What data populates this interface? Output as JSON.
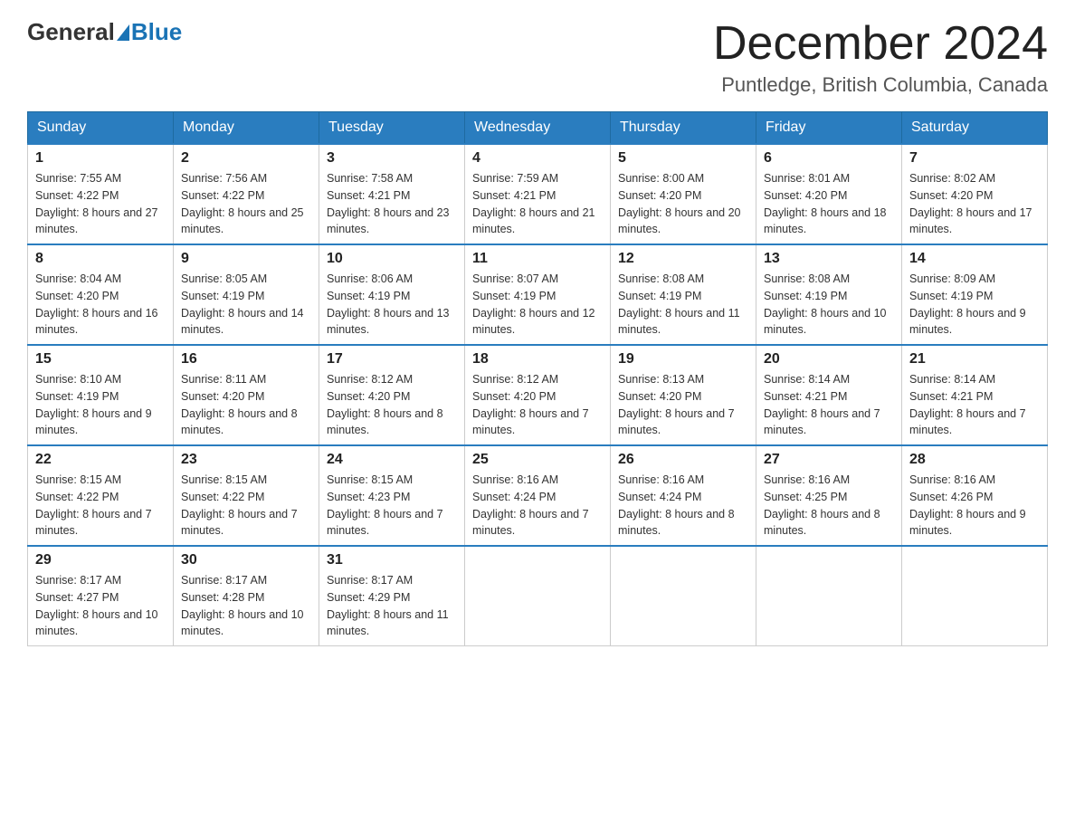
{
  "header": {
    "logo_general": "General",
    "logo_blue": "Blue",
    "month_title": "December 2024",
    "location": "Puntledge, British Columbia, Canada"
  },
  "days_of_week": [
    "Sunday",
    "Monday",
    "Tuesday",
    "Wednesday",
    "Thursday",
    "Friday",
    "Saturday"
  ],
  "weeks": [
    [
      {
        "day": "1",
        "sunrise": "7:55 AM",
        "sunset": "4:22 PM",
        "daylight": "8 hours and 27 minutes."
      },
      {
        "day": "2",
        "sunrise": "7:56 AM",
        "sunset": "4:22 PM",
        "daylight": "8 hours and 25 minutes."
      },
      {
        "day": "3",
        "sunrise": "7:58 AM",
        "sunset": "4:21 PM",
        "daylight": "8 hours and 23 minutes."
      },
      {
        "day": "4",
        "sunrise": "7:59 AM",
        "sunset": "4:21 PM",
        "daylight": "8 hours and 21 minutes."
      },
      {
        "day": "5",
        "sunrise": "8:00 AM",
        "sunset": "4:20 PM",
        "daylight": "8 hours and 20 minutes."
      },
      {
        "day": "6",
        "sunrise": "8:01 AM",
        "sunset": "4:20 PM",
        "daylight": "8 hours and 18 minutes."
      },
      {
        "day": "7",
        "sunrise": "8:02 AM",
        "sunset": "4:20 PM",
        "daylight": "8 hours and 17 minutes."
      }
    ],
    [
      {
        "day": "8",
        "sunrise": "8:04 AM",
        "sunset": "4:20 PM",
        "daylight": "8 hours and 16 minutes."
      },
      {
        "day": "9",
        "sunrise": "8:05 AM",
        "sunset": "4:19 PM",
        "daylight": "8 hours and 14 minutes."
      },
      {
        "day": "10",
        "sunrise": "8:06 AM",
        "sunset": "4:19 PM",
        "daylight": "8 hours and 13 minutes."
      },
      {
        "day": "11",
        "sunrise": "8:07 AM",
        "sunset": "4:19 PM",
        "daylight": "8 hours and 12 minutes."
      },
      {
        "day": "12",
        "sunrise": "8:08 AM",
        "sunset": "4:19 PM",
        "daylight": "8 hours and 11 minutes."
      },
      {
        "day": "13",
        "sunrise": "8:08 AM",
        "sunset": "4:19 PM",
        "daylight": "8 hours and 10 minutes."
      },
      {
        "day": "14",
        "sunrise": "8:09 AM",
        "sunset": "4:19 PM",
        "daylight": "8 hours and 9 minutes."
      }
    ],
    [
      {
        "day": "15",
        "sunrise": "8:10 AM",
        "sunset": "4:19 PM",
        "daylight": "8 hours and 9 minutes."
      },
      {
        "day": "16",
        "sunrise": "8:11 AM",
        "sunset": "4:20 PM",
        "daylight": "8 hours and 8 minutes."
      },
      {
        "day": "17",
        "sunrise": "8:12 AM",
        "sunset": "4:20 PM",
        "daylight": "8 hours and 8 minutes."
      },
      {
        "day": "18",
        "sunrise": "8:12 AM",
        "sunset": "4:20 PM",
        "daylight": "8 hours and 7 minutes."
      },
      {
        "day": "19",
        "sunrise": "8:13 AM",
        "sunset": "4:20 PM",
        "daylight": "8 hours and 7 minutes."
      },
      {
        "day": "20",
        "sunrise": "8:14 AM",
        "sunset": "4:21 PM",
        "daylight": "8 hours and 7 minutes."
      },
      {
        "day": "21",
        "sunrise": "8:14 AM",
        "sunset": "4:21 PM",
        "daylight": "8 hours and 7 minutes."
      }
    ],
    [
      {
        "day": "22",
        "sunrise": "8:15 AM",
        "sunset": "4:22 PM",
        "daylight": "8 hours and 7 minutes."
      },
      {
        "day": "23",
        "sunrise": "8:15 AM",
        "sunset": "4:22 PM",
        "daylight": "8 hours and 7 minutes."
      },
      {
        "day": "24",
        "sunrise": "8:15 AM",
        "sunset": "4:23 PM",
        "daylight": "8 hours and 7 minutes."
      },
      {
        "day": "25",
        "sunrise": "8:16 AM",
        "sunset": "4:24 PM",
        "daylight": "8 hours and 7 minutes."
      },
      {
        "day": "26",
        "sunrise": "8:16 AM",
        "sunset": "4:24 PM",
        "daylight": "8 hours and 8 minutes."
      },
      {
        "day": "27",
        "sunrise": "8:16 AM",
        "sunset": "4:25 PM",
        "daylight": "8 hours and 8 minutes."
      },
      {
        "day": "28",
        "sunrise": "8:16 AM",
        "sunset": "4:26 PM",
        "daylight": "8 hours and 9 minutes."
      }
    ],
    [
      {
        "day": "29",
        "sunrise": "8:17 AM",
        "sunset": "4:27 PM",
        "daylight": "8 hours and 10 minutes."
      },
      {
        "day": "30",
        "sunrise": "8:17 AM",
        "sunset": "4:28 PM",
        "daylight": "8 hours and 10 minutes."
      },
      {
        "day": "31",
        "sunrise": "8:17 AM",
        "sunset": "4:29 PM",
        "daylight": "8 hours and 11 minutes."
      },
      null,
      null,
      null,
      null
    ]
  ]
}
